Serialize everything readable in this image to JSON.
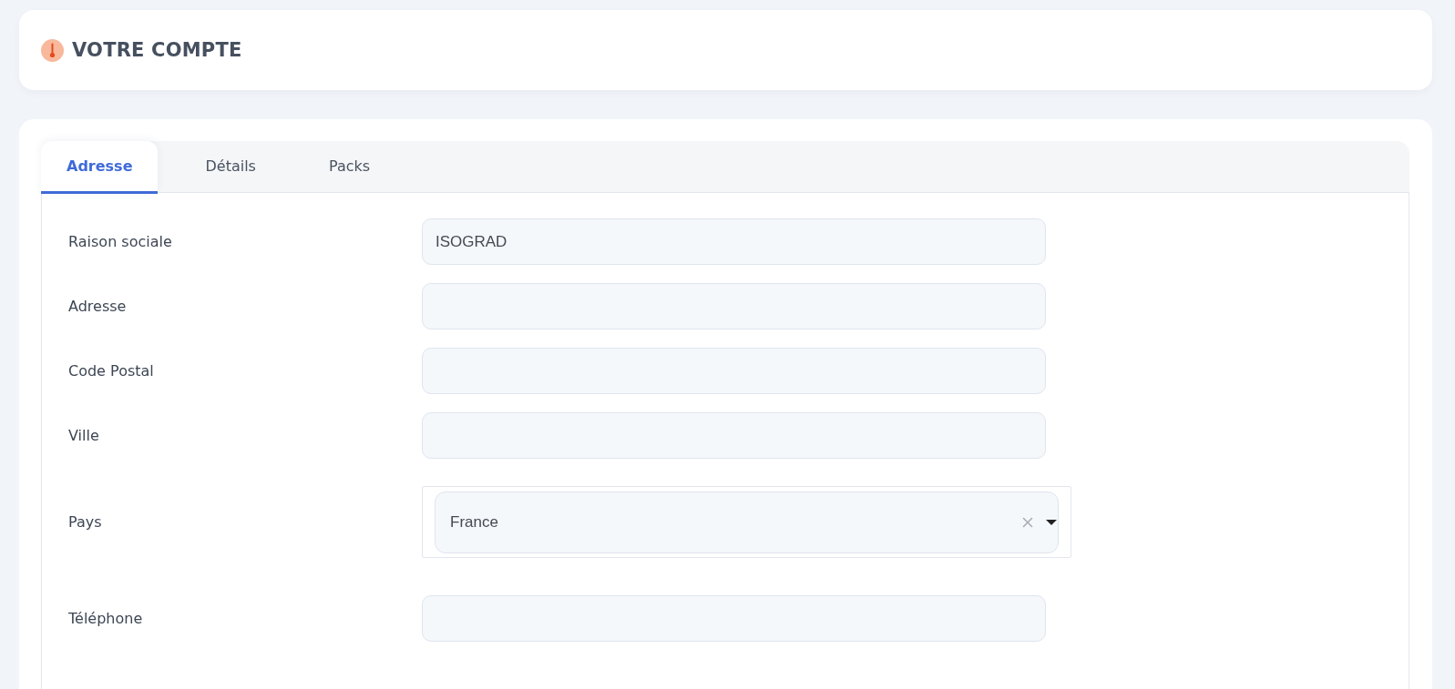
{
  "header": {
    "title": "VOTRE COMPTE"
  },
  "tabs": [
    {
      "label": "Adresse",
      "selected": true
    },
    {
      "label": "Détails",
      "selected": false
    },
    {
      "label": "Packs",
      "selected": false
    }
  ],
  "form": {
    "fields": [
      {
        "kind": "text",
        "label": "Raison sociale",
        "value": "ISOGRAD"
      },
      {
        "kind": "text",
        "label": "Adresse"
      },
      {
        "kind": "text",
        "label": "Code Postal"
      },
      {
        "kind": "text",
        "label": "Ville"
      },
      {
        "kind": "select",
        "label": "Pays",
        "value": "France",
        "clearable": true
      },
      {
        "kind": "text",
        "label": "Téléphone"
      }
    ]
  }
}
